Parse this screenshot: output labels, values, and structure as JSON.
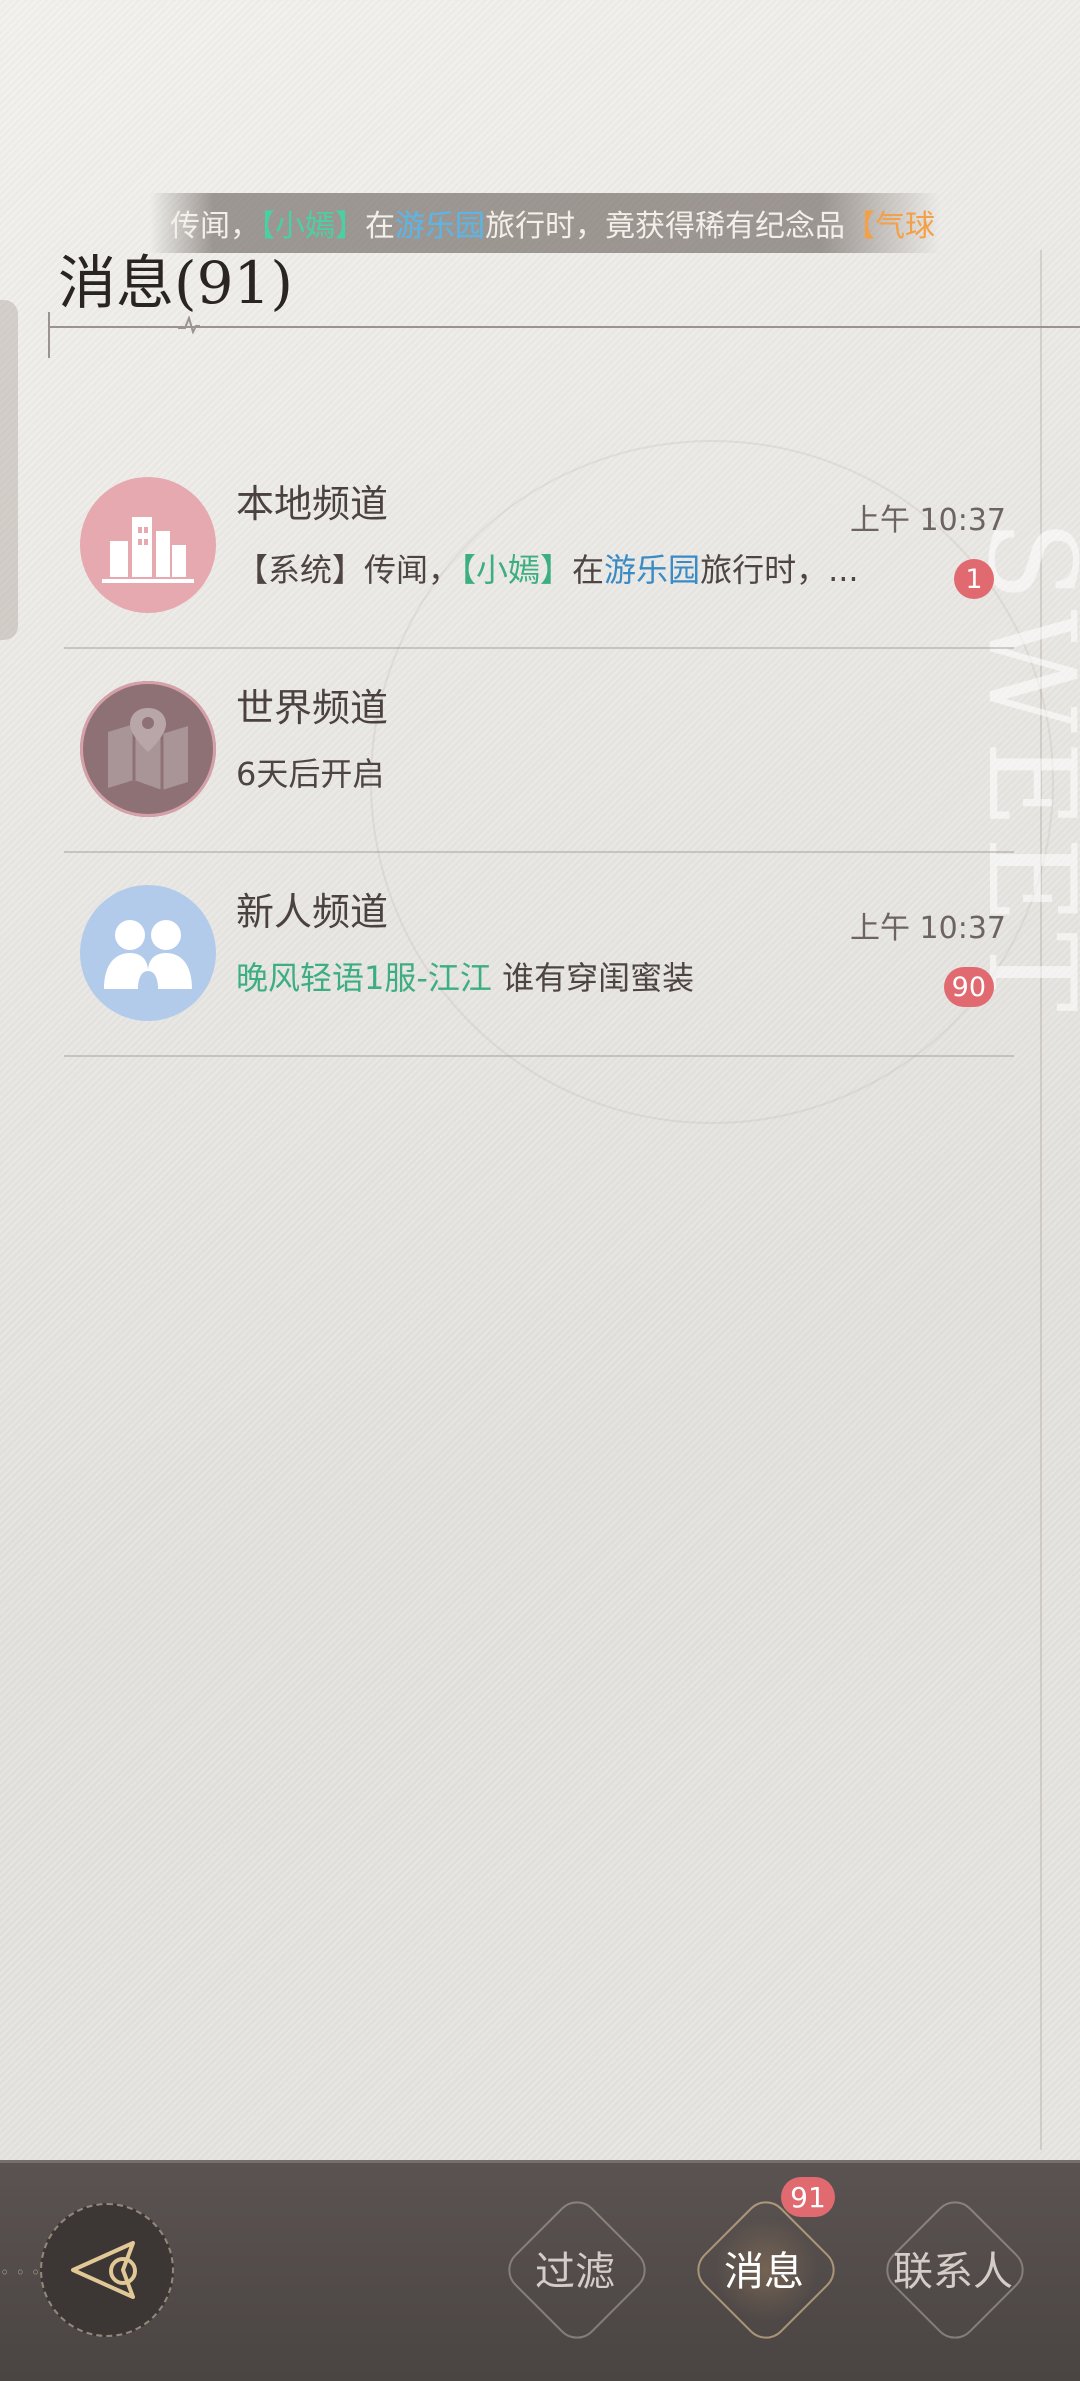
{
  "broadcast": {
    "prefix": "传闻，",
    "player": "【小嫣】",
    "mid1": "在",
    "place": "游乐园",
    "mid2": "旅行时，竟获得稀有纪念品",
    "item": "【气球"
  },
  "header": {
    "title": "消息(91)"
  },
  "channels": [
    {
      "name": "本地频道",
      "preview_prefix": "【系统】传闻，",
      "preview_player": "【小嫣】",
      "preview_mid": "在",
      "preview_place": "游乐园",
      "preview_suffix": "旅行时，...",
      "time": "上午 10:37",
      "unread": "1",
      "icon": "city-buildings-icon",
      "color": "#e6a9b0"
    },
    {
      "name": "世界频道",
      "preview": "6天后开启",
      "icon": "map-pin-icon",
      "color": "#8e7174"
    },
    {
      "name": "新人频道",
      "preview_sender": "晚风轻语1服-江江",
      "preview_text": " 谁有穿闺蜜装",
      "time": "上午 10:37",
      "unread": "90",
      "icon": "two-people-icon",
      "color": "#b2cbea"
    }
  ],
  "bottom_bar": {
    "filter_label": "过滤",
    "messages_label": "消息",
    "messages_badge": "91",
    "contacts_label": "联系人",
    "back_icon": "back-arrow-icon"
  },
  "decor": {
    "side_word": "SWEET"
  },
  "colors": {
    "badge": "#e06a6f",
    "accent_green": "#3cae80",
    "accent_blue": "#3a8bc4",
    "broadcast_item": "#f3a048"
  }
}
